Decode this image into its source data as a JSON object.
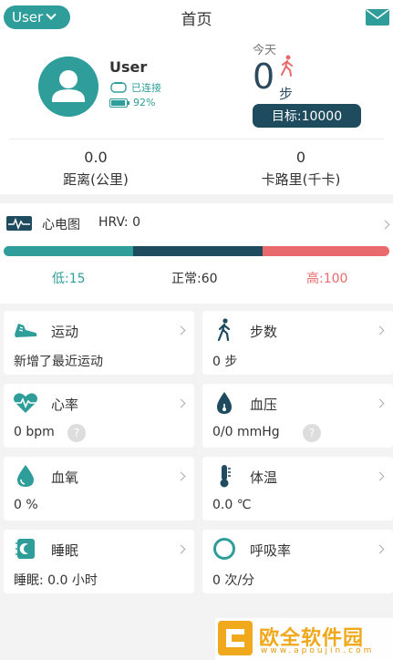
{
  "header": {
    "user_label": "User",
    "title": "首页"
  },
  "profile": {
    "name": "User",
    "connection_status": "已连接",
    "battery_percent": "92%",
    "today_label": "今天",
    "steps": "0",
    "steps_unit": "步",
    "goal": "目标:10000"
  },
  "stats": [
    {
      "value": "0.0",
      "label": "距离(公里)"
    },
    {
      "value": "0",
      "label": "卡路里(千卡)"
    }
  ],
  "ecg": {
    "title": "心电图",
    "hrv": "HRV: 0",
    "low": "低:15",
    "normal": "正常:60",
    "high": "高:100"
  },
  "cards": [
    {
      "title": "运动",
      "value": "新增了最近运动",
      "icon": "shoe-icon"
    },
    {
      "title": "步数",
      "value": "0 步",
      "icon": "walking-icon"
    },
    {
      "title": "心率",
      "value": "0 bpm",
      "icon": "heart-rate-icon"
    },
    {
      "title": "血压",
      "value": "0/0 mmHg",
      "icon": "blood-pressure-icon"
    },
    {
      "title": "血氧",
      "value": "0 %",
      "icon": "water-drop-icon"
    },
    {
      "title": "体温",
      "value": "0.0 ℃",
      "icon": "thermometer-icon"
    },
    {
      "title": "睡眠",
      "value": "睡眠: 0.0 小时",
      "icon": "moon-icon"
    },
    {
      "title": "呼吸率",
      "value": "0 次/分",
      "icon": "ring-icon"
    }
  ],
  "help_symbol": "?",
  "watermark": {
    "name": "欧全软件园",
    "url": "www.apoujin.com"
  },
  "colors": {
    "accent": "#2f9d9a",
    "dark": "#1f4b5f",
    "high": "#e86a6c"
  }
}
